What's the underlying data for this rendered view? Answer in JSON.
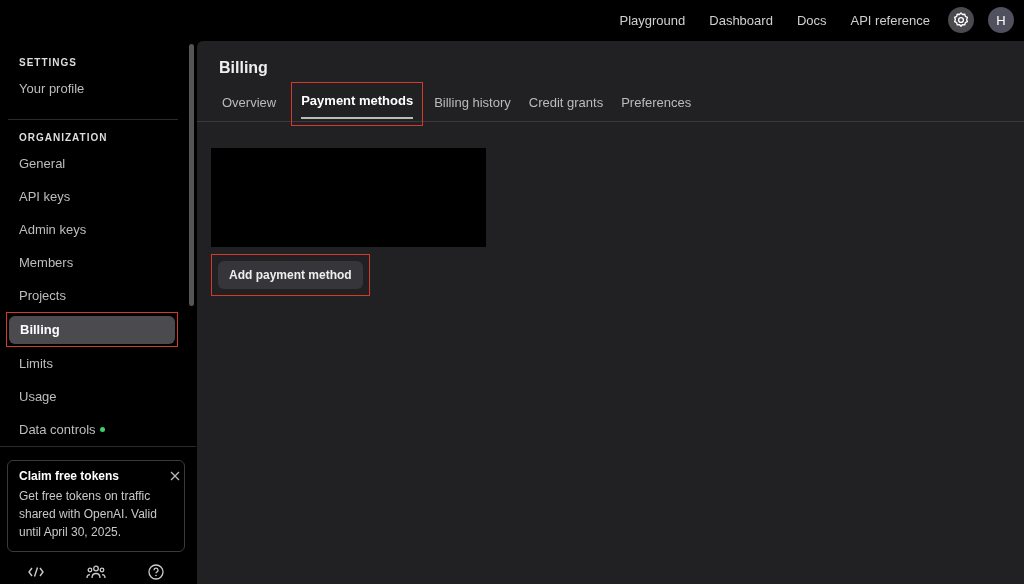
{
  "top_nav": {
    "links": [
      "Playground",
      "Dashboard",
      "Docs",
      "API reference"
    ],
    "avatar": "H"
  },
  "sidebar": {
    "sections": [
      {
        "heading": "SETTINGS",
        "items": [
          {
            "label": "Your profile",
            "selected": false,
            "highlighted": false,
            "dot": false
          }
        ]
      },
      {
        "heading": "ORGANIZATION",
        "items": [
          {
            "label": "General",
            "selected": false,
            "highlighted": false,
            "dot": false
          },
          {
            "label": "API keys",
            "selected": false,
            "highlighted": false,
            "dot": false
          },
          {
            "label": "Admin keys",
            "selected": false,
            "highlighted": false,
            "dot": false
          },
          {
            "label": "Members",
            "selected": false,
            "highlighted": false,
            "dot": false
          },
          {
            "label": "Projects",
            "selected": false,
            "highlighted": false,
            "dot": false
          },
          {
            "label": "Billing",
            "selected": true,
            "highlighted": true,
            "dot": false
          },
          {
            "label": "Limits",
            "selected": false,
            "highlighted": false,
            "dot": false
          },
          {
            "label": "Usage",
            "selected": false,
            "highlighted": false,
            "dot": false
          },
          {
            "label": "Data controls",
            "selected": false,
            "highlighted": false,
            "dot": true
          }
        ]
      }
    ],
    "promo": {
      "title": "Claim free tokens",
      "text": "Get free tokens on traffic shared with OpenAI. Valid until April 30, 2025."
    }
  },
  "page": {
    "title": "Billing",
    "tabs": [
      {
        "label": "Overview",
        "selected": false,
        "highlighted": false
      },
      {
        "label": "Payment methods",
        "selected": true,
        "highlighted": true
      },
      {
        "label": "Billing history",
        "selected": false,
        "highlighted": false
      },
      {
        "label": "Credit grants",
        "selected": false,
        "highlighted": false
      },
      {
        "label": "Preferences",
        "selected": false,
        "highlighted": false
      }
    ],
    "add_button": {
      "label": "Add payment method",
      "highlighted": true
    }
  }
}
